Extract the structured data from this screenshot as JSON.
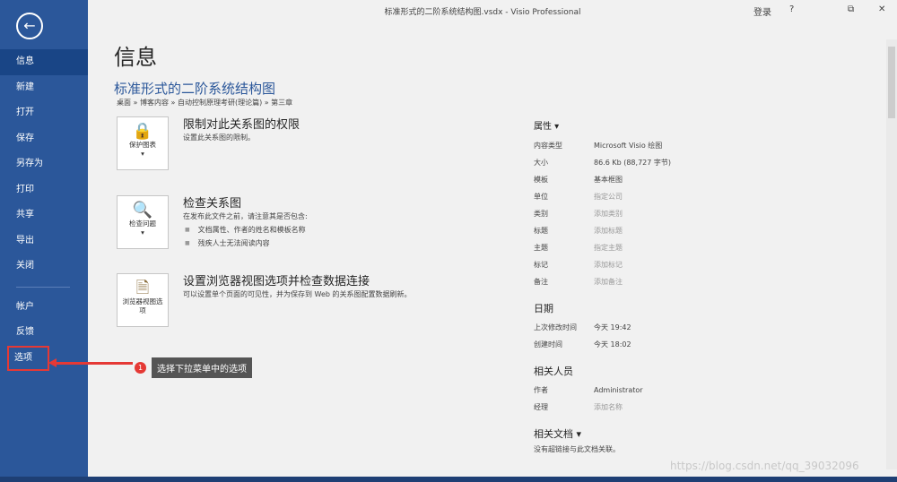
{
  "window": {
    "title": "标准形式的二阶系统结构图.vsdx  -  Visio Professional",
    "signin": "登录",
    "help": "?",
    "restore": "⧉",
    "close": "✕"
  },
  "sidebar": {
    "back_icon": "←",
    "items": [
      {
        "label": "信息"
      },
      {
        "label": "新建"
      },
      {
        "label": "打开"
      },
      {
        "label": "保存"
      },
      {
        "label": "另存为"
      },
      {
        "label": "打印"
      },
      {
        "label": "共享"
      },
      {
        "label": "导出"
      },
      {
        "label": "关闭"
      }
    ],
    "items2": [
      {
        "label": "帐户"
      },
      {
        "label": "反馈"
      },
      {
        "label": "选项"
      }
    ]
  },
  "main": {
    "page_title": "信息",
    "doc_title": "标准形式的二阶系统结构图",
    "breadcrumb": "桌面 » 博客内容 » 自动控制原理考研(理论篇) » 第三章",
    "sections": [
      {
        "tile_label": "保护图表",
        "tile_icon": "lock-icon",
        "heading": "限制对此关系图的权限",
        "desc": "设置此关系图的限制。"
      },
      {
        "tile_label": "检查问题",
        "tile_icon": "inspect-icon",
        "heading": "检查关系图",
        "desc": "在发布此文件之前，请注意其是否包含:",
        "bullets": [
          "文档属性、作者的姓名和模板名称",
          "残疾人士无法阅读内容"
        ]
      },
      {
        "tile_label": "浏览器视图选项",
        "tile_icon": "browser-view-icon",
        "heading": "设置浏览器视图选项并检查数据连接",
        "desc": "可以设置单个页面的可见性，并为保存到 Web 的关系图配置数据刷新。"
      }
    ]
  },
  "props": {
    "header": "属性 ▾",
    "rows": [
      {
        "key": "内容类型",
        "val": "Microsoft Visio 绘图"
      },
      {
        "key": "大小",
        "val": "86.6 Kb (88,727 字节)"
      },
      {
        "key": "模板",
        "val": "基本框图"
      },
      {
        "key": "单位",
        "val": "指定公司"
      },
      {
        "key": "类别",
        "val": "添加类别"
      },
      {
        "key": "标题",
        "val": "添加标题"
      },
      {
        "key": "主题",
        "val": "指定主题"
      },
      {
        "key": "标记",
        "val": "添加标记"
      },
      {
        "key": "备注",
        "val": "添加备注"
      }
    ],
    "dates_header": "日期",
    "dates": [
      {
        "key": "上次修改时间",
        "val": "今天 19:42"
      },
      {
        "key": "创建时间",
        "val": "今天 18:02"
      }
    ],
    "people_header": "相关人员",
    "people": [
      {
        "key": "作者",
        "val": "Administrator"
      },
      {
        "key": "经理",
        "val": "添加名称"
      }
    ],
    "docs_header": "相关文档 ▾",
    "docs_note": "没有超链接与此文档关联。"
  },
  "annotation": {
    "number": "1",
    "text": "选择下拉菜单中的选项"
  },
  "watermark": "https://blog.csdn.net/qq_39032096"
}
